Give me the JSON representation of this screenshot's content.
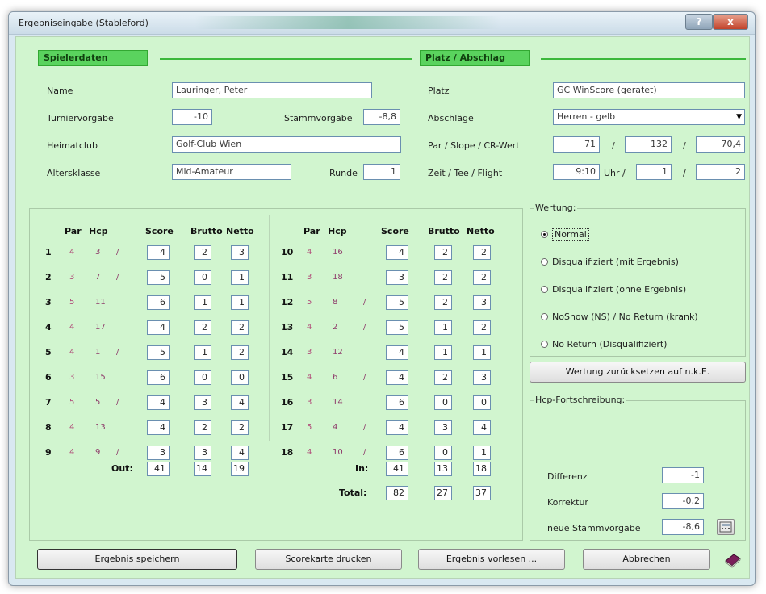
{
  "window": {
    "title": "Ergebniseingabe (Stableford)",
    "help_label": "?",
    "close_label": "x"
  },
  "player": {
    "header": "Spielerdaten",
    "name_label": "Name",
    "name": "Lauringer, Peter",
    "turnier_label": "Turniervorgabe",
    "turnier": "-10",
    "stamm_label": "Stammvorgabe",
    "stamm": "-8,8",
    "club_label": "Heimatclub",
    "club": "Golf-Club Wien",
    "alter_label": "Altersklasse",
    "alter": "Mid-Amateur",
    "runde_label": "Runde",
    "runde": "1"
  },
  "course": {
    "header": "Platz / Abschlag",
    "platz_label": "Platz",
    "platz": "GC WinScore (geratet)",
    "abschlag_label": "Abschläge",
    "abschlag": "Herren - gelb",
    "par_label": "Par / Slope / CR-Wert",
    "par": "71",
    "slope": "132",
    "cr": "70,4",
    "zeit_label": "Zeit / Tee / Flight",
    "zeit": "9:10",
    "uhr": "Uhr /",
    "tee": "1",
    "flight": "2",
    "sep": "/"
  },
  "score": {
    "headers": {
      "par": "Par",
      "hcp": "Hcp",
      "score": "Score",
      "brutto": "Brutto",
      "netto": "Netto"
    },
    "front": [
      {
        "hole": "1",
        "par": "4",
        "hcp": "3",
        "slash": "/",
        "score": "4",
        "brutto": "2",
        "netto": "3"
      },
      {
        "hole": "2",
        "par": "3",
        "hcp": "7",
        "slash": "/",
        "score": "5",
        "brutto": "0",
        "netto": "1"
      },
      {
        "hole": "3",
        "par": "5",
        "hcp": "11",
        "slash": "",
        "score": "6",
        "brutto": "1",
        "netto": "1"
      },
      {
        "hole": "4",
        "par": "4",
        "hcp": "17",
        "slash": "",
        "score": "4",
        "brutto": "2",
        "netto": "2"
      },
      {
        "hole": "5",
        "par": "4",
        "hcp": "1",
        "slash": "/",
        "score": "5",
        "brutto": "1",
        "netto": "2"
      },
      {
        "hole": "6",
        "par": "3",
        "hcp": "15",
        "slash": "",
        "score": "6",
        "brutto": "0",
        "netto": "0"
      },
      {
        "hole": "7",
        "par": "5",
        "hcp": "5",
        "slash": "/",
        "score": "4",
        "brutto": "3",
        "netto": "4"
      },
      {
        "hole": "8",
        "par": "4",
        "hcp": "13",
        "slash": "",
        "score": "4",
        "brutto": "2",
        "netto": "2"
      },
      {
        "hole": "9",
        "par": "4",
        "hcp": "9",
        "slash": "/",
        "score": "3",
        "brutto": "3",
        "netto": "4"
      }
    ],
    "back": [
      {
        "hole": "10",
        "par": "4",
        "hcp": "16",
        "slash": "",
        "score": "4",
        "brutto": "2",
        "netto": "2"
      },
      {
        "hole": "11",
        "par": "3",
        "hcp": "18",
        "slash": "",
        "score": "3",
        "brutto": "2",
        "netto": "2"
      },
      {
        "hole": "12",
        "par": "5",
        "hcp": "8",
        "slash": "/",
        "score": "5",
        "brutto": "2",
        "netto": "3"
      },
      {
        "hole": "13",
        "par": "4",
        "hcp": "2",
        "slash": "/",
        "score": "5",
        "brutto": "1",
        "netto": "2"
      },
      {
        "hole": "14",
        "par": "3",
        "hcp": "12",
        "slash": "",
        "score": "4",
        "brutto": "1",
        "netto": "1"
      },
      {
        "hole": "15",
        "par": "4",
        "hcp": "6",
        "slash": "/",
        "score": "4",
        "brutto": "2",
        "netto": "3"
      },
      {
        "hole": "16",
        "par": "3",
        "hcp": "14",
        "slash": "",
        "score": "6",
        "brutto": "0",
        "netto": "0"
      },
      {
        "hole": "17",
        "par": "5",
        "hcp": "4",
        "slash": "/",
        "score": "4",
        "brutto": "3",
        "netto": "4"
      },
      {
        "hole": "18",
        "par": "4",
        "hcp": "10",
        "slash": "/",
        "score": "6",
        "brutto": "0",
        "netto": "1"
      }
    ],
    "out": {
      "label": "Out:",
      "score": "41",
      "brutto": "14",
      "netto": "19"
    },
    "in": {
      "label": "In:",
      "score": "41",
      "brutto": "13",
      "netto": "18"
    },
    "total": {
      "label": "Total:",
      "score": "82",
      "brutto": "27",
      "netto": "37"
    }
  },
  "wertung": {
    "title": "Wertung:",
    "options": [
      {
        "label": "Normal",
        "checked": true
      },
      {
        "label": "Disqualifiziert (mit Ergebnis)",
        "checked": false
      },
      {
        "label": "Disqualifiziert (ohne Ergebnis)",
        "checked": false
      },
      {
        "label": "NoShow (NS) / No Return (krank)",
        "checked": false
      },
      {
        "label": "No Return (Disqualifiziert)",
        "checked": false
      }
    ],
    "reset_label": "Wertung zurücksetzen auf n.k.E."
  },
  "hcp": {
    "title": "Hcp-Fortschreibung:",
    "diff_label": "Differenz",
    "diff": "-1",
    "korr_label": "Korrektur",
    "korr": "-0,2",
    "neu_label": "neue Stammvorgabe",
    "neu": "-8,6"
  },
  "buttons": {
    "save": "Ergebnis speichern",
    "print": "Scorekarte drucken",
    "read": "Ergebnis vorlesen ...",
    "cancel": "Abbrechen"
  }
}
